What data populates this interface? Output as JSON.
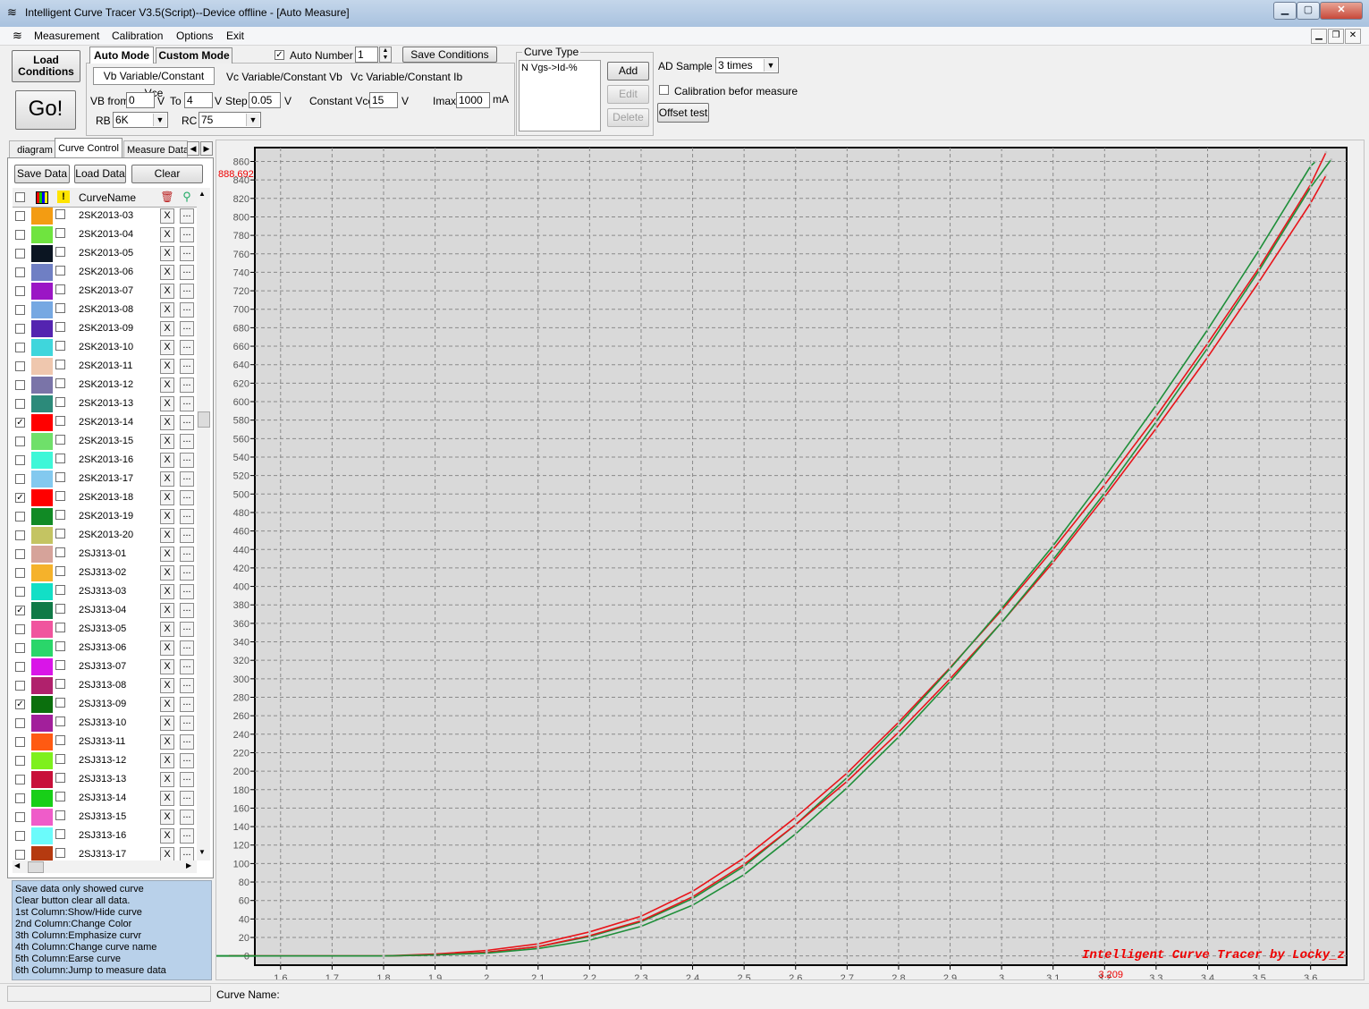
{
  "window": {
    "title": "Intelligent Curve Tracer V3.5(Script)--Device offline - [Auto Measure]"
  },
  "menu": {
    "items": [
      "Measurement",
      "Calibration",
      "Options",
      "Exit"
    ]
  },
  "toolbar": {
    "load_conditions": "Load\nConditions",
    "go": "Go!",
    "auto_mode_tab": "Auto Mode",
    "custom_mode_tab": "Custom Mode",
    "auto_number_label": "Auto Number",
    "auto_number_value": "1",
    "save_conditions": "Save Conditions",
    "subtabs": [
      "Vb Variable/Constant Vce",
      "Vc Variable/Constant Vb",
      "Vc Variable/Constant Ib"
    ],
    "vb_from_label": "VB from",
    "vb_from_value": "0",
    "v_unit": "V",
    "to_label": "To",
    "to_value": "4",
    "step_label": "Step",
    "step_value": "0.05",
    "constant_vce_label": "Constant Vce",
    "constant_vce_value": "15",
    "imax_label": "Imax",
    "imax_value": "1000",
    "ma_unit": "mA",
    "rb_label": "RB",
    "rb_value": "6K",
    "rc_label": "RC",
    "rc_value": "75",
    "curve_type_label": "Curve Type",
    "curve_type_item": "N Vgs->Id-%",
    "add": "Add",
    "edit": "Edit",
    "delete": "Delete",
    "ad_sample_label": "AD Sample",
    "ad_sample_value": "3 times",
    "calibration_label": "Calibration befor measure",
    "offset_test": "Offset test"
  },
  "left_tabs": [
    "diagram",
    "Curve Control",
    "Measure Data"
  ],
  "curve_control": {
    "save_data": "Save Data",
    "load_data": "Load Data",
    "clear": "Clear",
    "column_header": "CurveName",
    "x_label": "X",
    "dots_label": "...",
    "rows": [
      {
        "name": "2SK2013-03",
        "color": "#f39c12",
        "checked": false
      },
      {
        "name": "2SK2013-04",
        "color": "#6fe43f",
        "checked": false
      },
      {
        "name": "2SK2013-05",
        "color": "#0b1522",
        "checked": false
      },
      {
        "name": "2SK2013-06",
        "color": "#6f7fc4",
        "checked": false
      },
      {
        "name": "2SK2013-07",
        "color": "#9b16c5",
        "checked": false
      },
      {
        "name": "2SK2013-08",
        "color": "#76a8e2",
        "checked": false
      },
      {
        "name": "2SK2013-09",
        "color": "#5424b0",
        "checked": false
      },
      {
        "name": "2SK2013-10",
        "color": "#3fd6dc",
        "checked": false
      },
      {
        "name": "2SK2013-11",
        "color": "#efc7ae",
        "checked": false
      },
      {
        "name": "2SK2013-12",
        "color": "#7a74a8",
        "checked": false
      },
      {
        "name": "2SK2013-13",
        "color": "#2c8a7a",
        "checked": false
      },
      {
        "name": "2SK2013-14",
        "color": "#ff0000",
        "checked": true
      },
      {
        "name": "2SK2013-15",
        "color": "#6fe06a",
        "checked": false
      },
      {
        "name": "2SK2013-16",
        "color": "#3ef7d8",
        "checked": false
      },
      {
        "name": "2SK2013-17",
        "color": "#83c9ef",
        "checked": false
      },
      {
        "name": "2SK2013-18",
        "color": "#ff0000",
        "checked": true
      },
      {
        "name": "2SK2013-19",
        "color": "#118a25",
        "checked": false
      },
      {
        "name": "2SK2013-20",
        "color": "#c4c462",
        "checked": false
      },
      {
        "name": "2SJ313-01",
        "color": "#d6a39a",
        "checked": false
      },
      {
        "name": "2SJ313-02",
        "color": "#f5b22b",
        "checked": false
      },
      {
        "name": "2SJ313-03",
        "color": "#12dfc6",
        "checked": false
      },
      {
        "name": "2SJ313-04",
        "color": "#0f7a47",
        "checked": true
      },
      {
        "name": "2SJ313-05",
        "color": "#f0559e",
        "checked": false
      },
      {
        "name": "2SJ313-06",
        "color": "#2ad66a",
        "checked": false
      },
      {
        "name": "2SJ313-07",
        "color": "#d915e8",
        "checked": false
      },
      {
        "name": "2SJ313-08",
        "color": "#b0216c",
        "checked": false
      },
      {
        "name": "2SJ313-09",
        "color": "#0b6f0d",
        "checked": true
      },
      {
        "name": "2SJ313-10",
        "color": "#a21f9b",
        "checked": false
      },
      {
        "name": "2SJ313-11",
        "color": "#ff5a12",
        "checked": false
      },
      {
        "name": "2SJ313-12",
        "color": "#7ef01d",
        "checked": false
      },
      {
        "name": "2SJ313-13",
        "color": "#c8103a",
        "checked": false
      },
      {
        "name": "2SJ313-14",
        "color": "#18cf18",
        "checked": false
      },
      {
        "name": "2SJ313-15",
        "color": "#ef5cc9",
        "checked": false
      },
      {
        "name": "2SJ313-16",
        "color": "#6bfbfb",
        "checked": false
      },
      {
        "name": "2SJ313-17",
        "color": "#b53a10",
        "checked": false
      }
    ],
    "help_lines": [
      "  Save data only showed curve",
      "  Clear button clear all data.",
      "1st Column:Show/Hide curve",
      "2nd Column:Change Color",
      "3th Column:Emphasize curvr",
      "4th Column:Change curve name",
      "5th Column:Earse curve",
      "6th Column:Jump to measure data"
    ]
  },
  "status": {
    "curve_name_label": "Curve Name:"
  },
  "chart_data": {
    "type": "line",
    "xlim": [
      1.55,
      3.67
    ],
    "ylim": [
      -10,
      875
    ],
    "x_ticks": [
      1.6,
      1.7,
      1.8,
      1.9,
      2,
      2.1,
      2.2,
      2.3,
      2.4,
      2.5,
      2.6,
      2.7,
      2.8,
      2.9,
      3,
      3.1,
      3.2,
      3.3,
      3.4,
      3.5,
      3.6
    ],
    "y_ticks": [
      0,
      20,
      40,
      60,
      80,
      100,
      120,
      140,
      160,
      180,
      200,
      220,
      240,
      260,
      280,
      300,
      320,
      340,
      360,
      380,
      400,
      420,
      440,
      460,
      480,
      500,
      520,
      540,
      560,
      580,
      600,
      620,
      640,
      660,
      680,
      700,
      720,
      740,
      760,
      780,
      800,
      820,
      840,
      860
    ],
    "grid": true,
    "cursor_y_label": "888.692",
    "cursor_x_label": "3.209",
    "watermark": "Intelligent Curve Tracer by Locky_z",
    "series": [
      {
        "color": "#e8141a",
        "x": [
          1.5,
          1.8,
          1.9,
          2.0,
          2.1,
          2.2,
          2.3,
          2.4,
          2.5,
          2.6,
          2.7,
          2.8,
          2.9,
          3.0,
          3.1,
          3.2,
          3.3,
          3.4,
          3.5,
          3.6,
          3.63
        ],
        "y": [
          0,
          0,
          2,
          6,
          13,
          26,
          43,
          70,
          106,
          150,
          198,
          253,
          312,
          374,
          440,
          510,
          584,
          663,
          745,
          835,
          870
        ]
      },
      {
        "color": "#1f8f3a",
        "x": [
          1.5,
          1.8,
          1.9,
          2.0,
          2.1,
          2.2,
          2.3,
          2.4,
          2.5,
          2.6,
          2.7,
          2.8,
          2.9,
          3.0,
          3.1,
          3.2,
          3.3,
          3.4,
          3.5,
          3.6,
          3.61
        ],
        "y": [
          0,
          0,
          1,
          4,
          10,
          21,
          37,
          62,
          97,
          142,
          193,
          250,
          311,
          376,
          444,
          518,
          596,
          678,
          764,
          855,
          860
        ]
      },
      {
        "color": "#e8141a",
        "x": [
          1.5,
          1.8,
          1.9,
          2.0,
          2.1,
          2.2,
          2.3,
          2.4,
          2.5,
          2.6,
          2.7,
          2.8,
          2.9,
          3.0,
          3.1,
          3.2,
          3.3,
          3.4,
          3.5,
          3.6,
          3.63
        ],
        "y": [
          0,
          0,
          1,
          4,
          10,
          22,
          38,
          64,
          99,
          142,
          189,
          242,
          300,
          361,
          426,
          497,
          571,
          648,
          730,
          815,
          845
        ]
      },
      {
        "color": "#1f8f3a",
        "x": [
          1.5,
          1.8,
          1.9,
          2.0,
          2.1,
          2.2,
          2.3,
          2.4,
          2.5,
          2.6,
          2.7,
          2.8,
          2.9,
          3.0,
          3.1,
          3.2,
          3.3,
          3.4,
          3.5,
          3.6,
          3.64
        ],
        "y": [
          0,
          0,
          1,
          3,
          8,
          17,
          32,
          55,
          88,
          132,
          182,
          237,
          297,
          361,
          429,
          501,
          578,
          658,
          742,
          832,
          862
        ]
      }
    ]
  }
}
